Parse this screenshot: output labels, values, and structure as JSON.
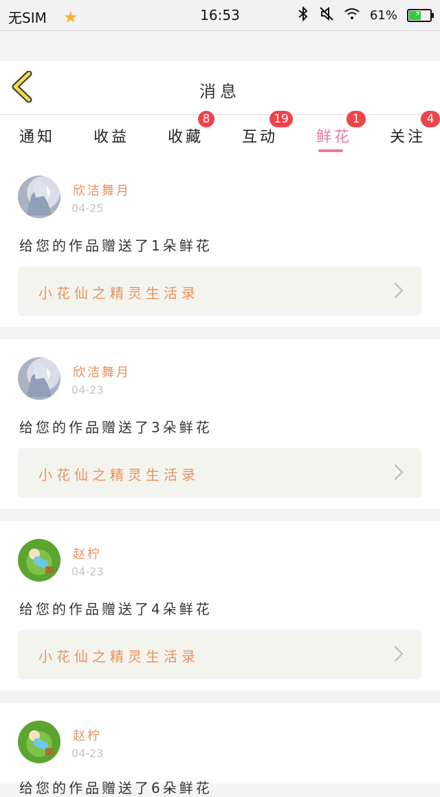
{
  "status_bar": {
    "carrier": "无SIM",
    "time": "16:53",
    "battery_percent": "61%",
    "battery_level": 0.61,
    "icons": [
      "star-icon",
      "bluetooth-icon",
      "mute-icon",
      "wifi-icon",
      "battery-icon"
    ]
  },
  "header": {
    "title": "消息",
    "back_icon": "chevron-left-icon"
  },
  "tabs": [
    {
      "label": "通知",
      "badge": ""
    },
    {
      "label": "收益",
      "badge": ""
    },
    {
      "label": "收藏",
      "badge": "8"
    },
    {
      "label": "互动",
      "badge": "19"
    },
    {
      "label": "鲜花",
      "badge": "1",
      "active": true
    },
    {
      "label": "关注",
      "badge": "4"
    }
  ],
  "messages": [
    {
      "user": "欣洁舞月",
      "date": "04-25",
      "text": "给您的作品赠送了1朵鲜花",
      "work_title": "小花仙之精灵生活录",
      "avatar": "avatar-anime"
    },
    {
      "user": "欣洁舞月",
      "date": "04-23",
      "text": "给您的作品赠送了3朵鲜花",
      "work_title": "小花仙之精灵生活录",
      "avatar": "avatar-anime"
    },
    {
      "user": "赵柠",
      "date": "04-23",
      "text": "给您的作品赠送了4朵鲜花",
      "work_title": "小花仙之精灵生活录",
      "avatar": "avatar-boy-grass"
    },
    {
      "user": "赵柠",
      "date": "04-23",
      "text": "给您的作品赠送了6朵鲜花",
      "work_title": "",
      "avatar": "avatar-boy-grass"
    }
  ],
  "colors": {
    "accent_pink": "#e87aa8",
    "username_orange": "#e8925b",
    "badge_red": "#f2424a",
    "back_yellow": "#f3d84a"
  }
}
